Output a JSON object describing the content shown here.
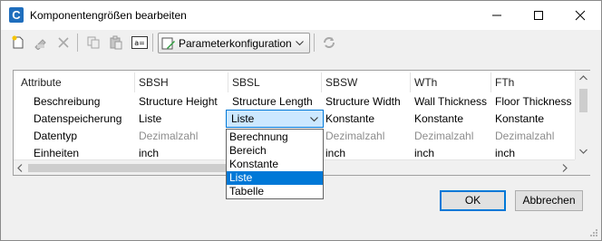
{
  "window": {
    "title": "Komponentengrößen bearbeiten",
    "app_icon_letter": "C",
    "accent_color": "#0078d7"
  },
  "toolbar": {
    "dropdown_label": "Parameterkonfiguration",
    "icons": [
      "new-icon",
      "edit-icon",
      "delete-icon",
      "copy-icon",
      "paste-icon",
      "insert-variable-icon",
      "parameter-config-icon",
      "refresh-icon"
    ]
  },
  "grid": {
    "columns": [
      "Attribute",
      "SBSH",
      "SBSL",
      "SBSW",
      "WTh",
      "FTh"
    ],
    "rows": [
      {
        "label": "Beschreibung",
        "cells": [
          "Structure Height",
          "Structure Length",
          "Structure Width",
          "Wall Thickness",
          "Floor Thickness"
        ],
        "muted": false
      },
      {
        "label": "Datenspeicherung",
        "cells": [
          "Liste",
          "",
          "Konstante",
          "Konstante",
          "Konstante"
        ],
        "muted": false
      },
      {
        "label": "Datentyp",
        "cells": [
          "Dezimalzahl",
          "",
          "Dezimalzahl",
          "Dezimalzahl",
          "Dezimalzahl"
        ],
        "muted": true
      },
      {
        "label": "Einheiten",
        "cells": [
          "inch",
          "",
          "inch",
          "inch",
          "inch"
        ],
        "muted": false
      }
    ]
  },
  "combo": {
    "value": "Liste",
    "options": [
      "Berechnung",
      "Bereich",
      "Konstante",
      "Liste",
      "Tabelle"
    ],
    "selected_index": 3
  },
  "buttons": {
    "ok": "OK",
    "cancel": "Abbrechen"
  }
}
